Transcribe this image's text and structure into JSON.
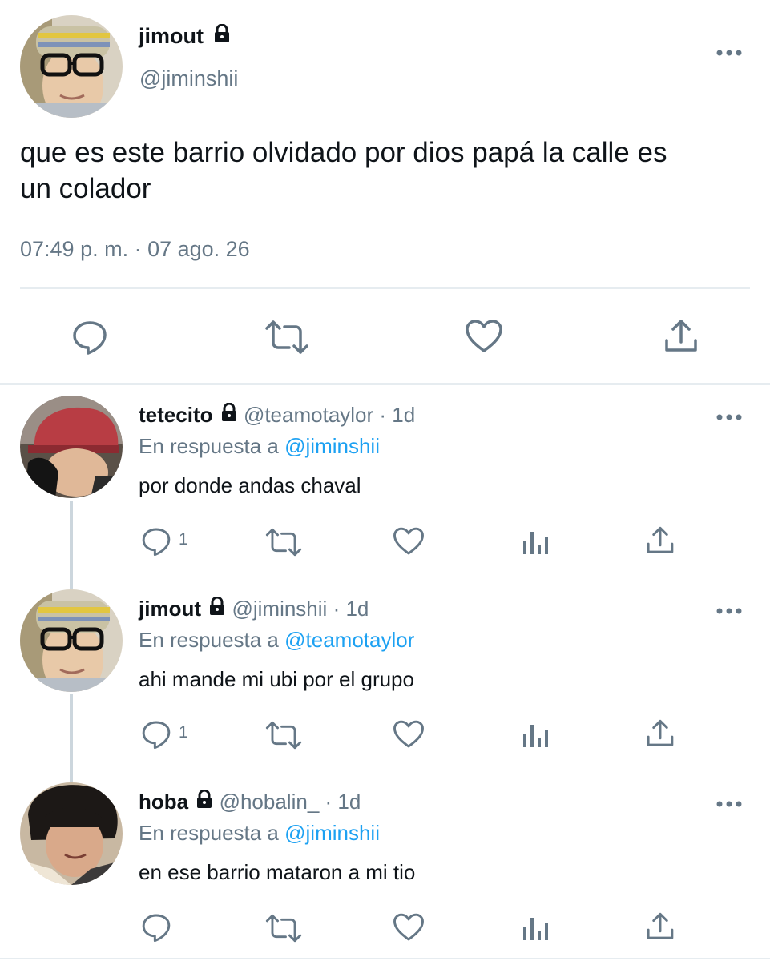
{
  "main_tweet": {
    "display_name": "jimout",
    "handle": "@jiminshii",
    "text_line1": "que es este barrio olvidado por dios papá la calle es",
    "text_line2": "un colador",
    "timestamp": "07:49 p. m. · 07 ago. 26",
    "actions": [
      "reply-icon",
      "retweet-icon",
      "like-icon",
      "share-icon"
    ]
  },
  "replies": [
    {
      "display_name": "tetecito",
      "handle": "@teamotaylor",
      "time": "· 1d",
      "reply_prefix": "En respuesta a",
      "reply_to": "@jiminshii",
      "text": "por donde andas chaval",
      "reply_count": "1"
    },
    {
      "display_name": "jimout",
      "handle": "@jiminshii",
      "time": "· 1d",
      "reply_prefix": "En respuesta a",
      "reply_to": "@teamotaylor",
      "text": "ahi mande mi ubi por el grupo",
      "reply_count": "1"
    },
    {
      "display_name": "hoba",
      "handle": "@hobalin_",
      "time": "· 1d",
      "reply_prefix": "En respuesta a",
      "reply_to": "@jiminshii",
      "text": "en ese barrio mataron a mi tio",
      "reply_count": ""
    }
  ],
  "colors": {
    "text": "#0f1419",
    "secondary": "#657786",
    "link": "#1da1f2",
    "divider": "#e6ecf0"
  }
}
